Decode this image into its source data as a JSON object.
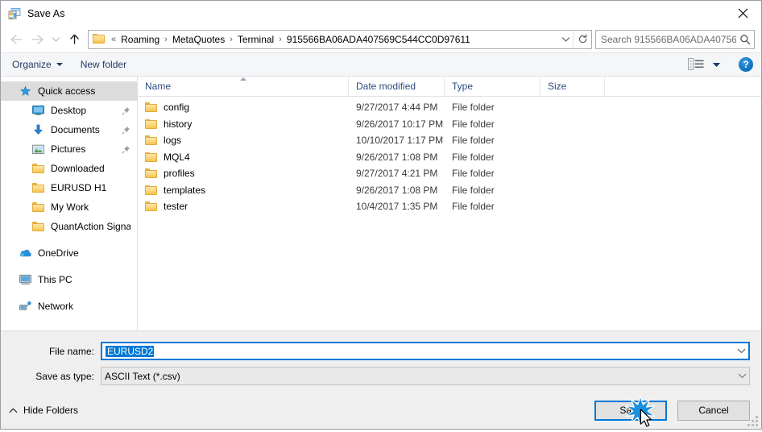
{
  "window": {
    "title": "Save As",
    "app_icon": "save-as-app-icon",
    "close_label": "✕"
  },
  "nav": {
    "back_icon": "back-arrow-icon",
    "forward_icon": "forward-arrow-icon",
    "recent_icon": "chevron-down-icon",
    "up_icon": "up-arrow-icon",
    "breadcrumb_prefix": "«",
    "breadcrumbs": [
      "Roaming",
      "MetaQuotes",
      "Terminal",
      "915566BA06ADA407569C544CC0D97611"
    ],
    "separator": "›",
    "dropdown_icon": "chevron-down-icon",
    "refresh_icon": "refresh-icon"
  },
  "search": {
    "placeholder": "Search 915566BA06ADA40756...",
    "icon": "search-icon"
  },
  "toolbar": {
    "organize_label": "Organize",
    "new_folder_label": "New folder",
    "view_icon": "view-options-icon",
    "view_caret_icon": "chevron-down-icon",
    "help_label": "?"
  },
  "sidebar": {
    "items": [
      {
        "label": "Quick access",
        "icon": "star-pin-icon",
        "level": 0,
        "selected": true,
        "pinned": false
      },
      {
        "label": "Desktop",
        "icon": "desktop-icon",
        "level": 1,
        "selected": false,
        "pinned": true
      },
      {
        "label": "Documents",
        "icon": "documents-download-icon",
        "level": 1,
        "selected": false,
        "pinned": true
      },
      {
        "label": "Pictures",
        "icon": "pictures-icon",
        "level": 1,
        "selected": false,
        "pinned": true
      },
      {
        "label": "Downloaded",
        "icon": "folder-icon",
        "level": 1,
        "selected": false,
        "pinned": false
      },
      {
        "label": "EURUSD H1",
        "icon": "folder-icon",
        "level": 1,
        "selected": false,
        "pinned": false
      },
      {
        "label": "My Work",
        "icon": "folder-icon",
        "level": 1,
        "selected": false,
        "pinned": false
      },
      {
        "label": "QuantAction Signal",
        "icon": "folder-icon",
        "level": 1,
        "selected": false,
        "pinned": false
      },
      {
        "label": "OneDrive",
        "icon": "onedrive-icon",
        "level": 0,
        "selected": false,
        "pinned": false,
        "gap_before": true
      },
      {
        "label": "This PC",
        "icon": "this-pc-icon",
        "level": 0,
        "selected": false,
        "pinned": false,
        "gap_before": true
      },
      {
        "label": "Network",
        "icon": "network-icon",
        "level": 0,
        "selected": false,
        "pinned": false,
        "gap_before": true
      }
    ]
  },
  "filelist": {
    "columns": [
      {
        "key": "name",
        "label": "Name",
        "sorted": true,
        "sort_dir": "asc"
      },
      {
        "key": "date",
        "label": "Date modified",
        "sorted": false
      },
      {
        "key": "type",
        "label": "Type",
        "sorted": false
      },
      {
        "key": "size",
        "label": "Size",
        "sorted": false
      }
    ],
    "rows": [
      {
        "name": "config",
        "date": "9/27/2017 4:44 PM",
        "type": "File folder",
        "size": "",
        "icon": "folder-icon"
      },
      {
        "name": "history",
        "date": "9/26/2017 10:17 PM",
        "type": "File folder",
        "size": "",
        "icon": "folder-icon"
      },
      {
        "name": "logs",
        "date": "10/10/2017 1:17 PM",
        "type": "File folder",
        "size": "",
        "icon": "folder-icon"
      },
      {
        "name": "MQL4",
        "date": "9/26/2017 1:08 PM",
        "type": "File folder",
        "size": "",
        "icon": "folder-icon"
      },
      {
        "name": "profiles",
        "date": "9/27/2017 4:21 PM",
        "type": "File folder",
        "size": "",
        "icon": "folder-icon"
      },
      {
        "name": "templates",
        "date": "9/26/2017 1:08 PM",
        "type": "File folder",
        "size": "",
        "icon": "folder-icon"
      },
      {
        "name": "tester",
        "date": "10/4/2017 1:35 PM",
        "type": "File folder",
        "size": "",
        "icon": "folder-icon"
      }
    ]
  },
  "form": {
    "filename_label": "File name:",
    "filename_value": "EURUSD2",
    "filetype_label": "Save as type:",
    "filetype_value": "ASCII Text (*.csv)"
  },
  "footer": {
    "hide_folders_label": "Hide Folders",
    "hide_folders_icon": "chevron-up-icon",
    "save_label": "Save",
    "cancel_label": "Cancel",
    "resize_grip_icon": "resize-grip-icon",
    "cursor_icon": "mouse-pointer-icon",
    "click_effect_icon": "click-burst-icon"
  },
  "colors": {
    "accent": "#0078d7",
    "header_text": "#2b4b80",
    "toolbar_bg": "#f5f6f7",
    "panel_bg": "#efefef",
    "selection_bg": "#dcdcdc",
    "folder_yellow": "#fcd67a"
  }
}
